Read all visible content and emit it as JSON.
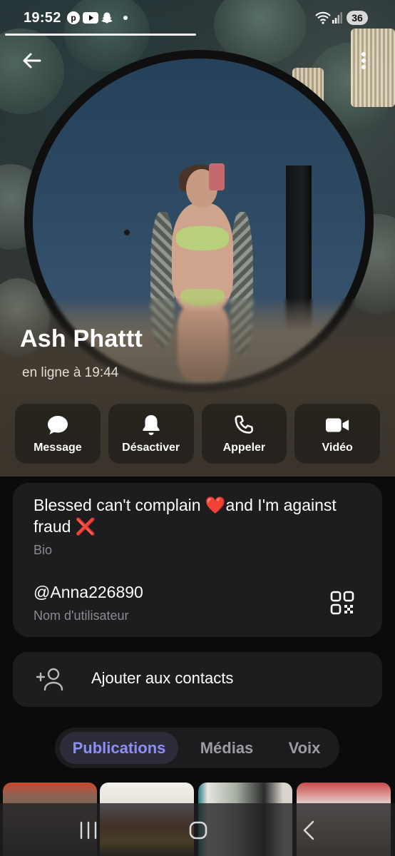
{
  "status_bar": {
    "time": "19:52",
    "battery": "36",
    "notification_icons": [
      "pinterest-icon",
      "youtube-icon",
      "snapchat-icon",
      "dot-icon"
    ],
    "system_icons": [
      "wifi-icon",
      "signal-icon"
    ]
  },
  "profile": {
    "name": "Ash Phattt",
    "last_seen": "en ligne à 19:44"
  },
  "actions": [
    {
      "label": "Message",
      "icon": "chat-bubble-icon"
    },
    {
      "label": "Désactiver",
      "icon": "bell-icon"
    },
    {
      "label": "Appeler",
      "icon": "phone-icon"
    },
    {
      "label": "Vidéo",
      "icon": "video-camera-icon"
    }
  ],
  "info": {
    "bio_part1": "Blessed can't complain ",
    "bio_emoji_heart": "❤️",
    "bio_part2": "and I'm against fraud ",
    "bio_emoji_cross": "❌",
    "bio_label": "Bio",
    "username": "@Anna226890",
    "username_label": "Nom d'utilisateur"
  },
  "add_contact": {
    "label": "Ajouter aux contacts",
    "icon": "add-user-icon"
  },
  "tabs": [
    {
      "label": "Publications",
      "active": true
    },
    {
      "label": "Médias",
      "active": false
    },
    {
      "label": "Voix",
      "active": false
    }
  ],
  "colors": {
    "accent_tab_text": "#8e8ff4",
    "card_background": "#1d1d1f",
    "heart": "#e0242c"
  }
}
